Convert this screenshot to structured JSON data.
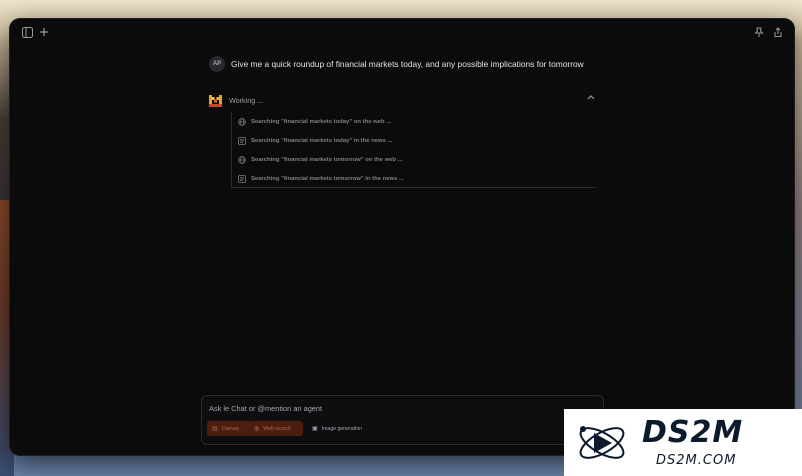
{
  "topbar": {
    "left_icons": [
      "sidebar-toggle-icon",
      "plus-icon"
    ],
    "right_icons": [
      "pin-icon",
      "share-icon"
    ]
  },
  "conversation": {
    "user_avatar": "AP",
    "user_message": "Give me a quick roundup of financial markets today, and any possible implications for tomorrow"
  },
  "status": {
    "label": "Working ..."
  },
  "steps": [
    {
      "icon": "globe-icon",
      "text": "Searching \"financial markets today\" on the web ..."
    },
    {
      "icon": "news-icon",
      "text": "Searching \"financial markets today\" in the news ..."
    },
    {
      "icon": "globe-icon",
      "text": "Searching \"financial markets tomorrow\" on the web ..."
    },
    {
      "icon": "news-icon",
      "text": "Searching \"financial markets tomorrow\" in the news ..."
    }
  ],
  "composer": {
    "placeholder": "Ask le Chat or @mention an agent",
    "tools": {
      "canvas": "Canvas",
      "web_search": "Web search",
      "image_generation": "Image generation"
    }
  },
  "watermark": {
    "brand": "DS2M",
    "domain": "DS2M.COM"
  },
  "colors": {
    "app_bg": "#0b0b0c",
    "accent_orange": "#b26a43",
    "chip_bg": "#4a1f12"
  }
}
